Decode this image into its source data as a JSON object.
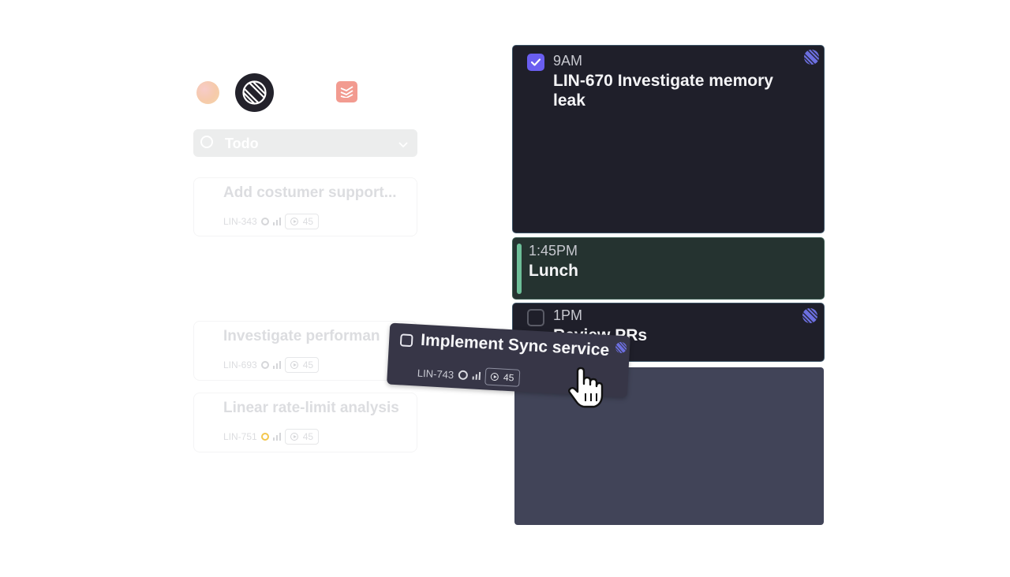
{
  "integrations": [
    {
      "name": "gradient-app"
    },
    {
      "name": "linear"
    },
    {
      "name": "todoist"
    }
  ],
  "todo_select": {
    "label": "Todo"
  },
  "faded_cards": [
    {
      "title": "Add costumer support...",
      "id": "LIN-343",
      "estimate": "45",
      "status": "todo"
    },
    {
      "title": "Investigate performan",
      "id": "LIN-693",
      "estimate": "45",
      "status": "todo"
    },
    {
      "title": "Linear rate-limit analysis",
      "id": "LIN-751",
      "estimate": "45",
      "status": "in-progress"
    }
  ],
  "events": [
    {
      "time": "9AM",
      "title": "LIN-670 Investigate memory leak",
      "done": true
    },
    {
      "time": "1:45PM",
      "title": "Lunch"
    },
    {
      "time": "1PM",
      "title": "Review PRs",
      "done": false
    }
  ],
  "drag_card": {
    "title": "Implement Sync service",
    "id": "LIN-743",
    "estimate": "45"
  },
  "colors": {
    "event_dark": "#1f1f2a",
    "lunch_bg": "#253330",
    "lunch_accent": "#6dbf98",
    "check_purple": "#6a5ef0",
    "drop_zone": "#414458",
    "todoist_red": "#f29b90"
  }
}
